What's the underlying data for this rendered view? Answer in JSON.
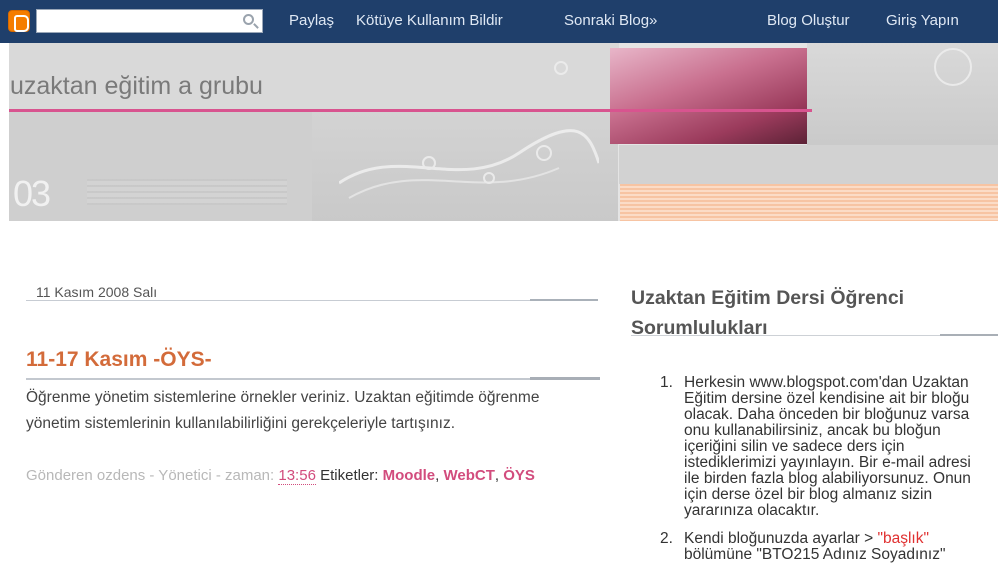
{
  "navbar": {
    "search_placeholder": "",
    "links": {
      "share": "Paylaş",
      "report": "Kötüye Kullanım Bildir",
      "next_blog": "Sonraki Blog»",
      "create_blog": "Blog Oluştur",
      "sign_in": "Giriş Yapın"
    }
  },
  "header": {
    "title": "uzaktan eğitim a grubu",
    "decor_number": "03"
  },
  "post": {
    "date": "11 Kasım 2008 Salı",
    "title": "11-17 Kasım -ÖYS-",
    "body": "Öğrenme yönetim sistemlerine örnekler veriniz. Uzaktan eğitimde öğrenme yönetim sistemlerinin kullanılabilirliğini gerekçeleriyle tartışınız.",
    "footer": {
      "posted_by": "Gönderen ozdens - Yönetici - zaman:",
      "time": "13:56",
      "labels_prefix": "Etiketler:",
      "labels": [
        "Moodle",
        "WebCT",
        "ÖYS"
      ],
      "separator": ", "
    }
  },
  "sidebar": {
    "title": "Uzaktan Eğitim Dersi Öğrenci Sorumlulukları",
    "items": [
      {
        "num": "1.",
        "text": "Herkesin www.blogspot.com'dan Uzaktan Eğitim dersine özel kendisine ait bir bloğu olacak. Daha önceden bir bloğunuz varsa onu kullanabilirsiniz, ancak bu bloğun içeriğini silin ve sadece ders için istediklerimizi yayınlayın. Bir e-mail adresi ile birden fazla blog alabiliyorsunuz. Onun için derse özel bir blog almanız sizin yararınıza olacaktır."
      },
      {
        "num": "2.",
        "text_before": "Kendi bloğunuzda ayarlar > ",
        "highlight": "\"başlık\"",
        "text_after": " bölümüne \"BTO215 Adınız Soyadınız\""
      }
    ]
  },
  "colors": {
    "navbar_bg": "#1f3f6b",
    "post_title": "#d36b3a",
    "link_pink": "#d24c7d",
    "accent_pink_line": "#d8548f",
    "highlight_red": "#e03030"
  }
}
